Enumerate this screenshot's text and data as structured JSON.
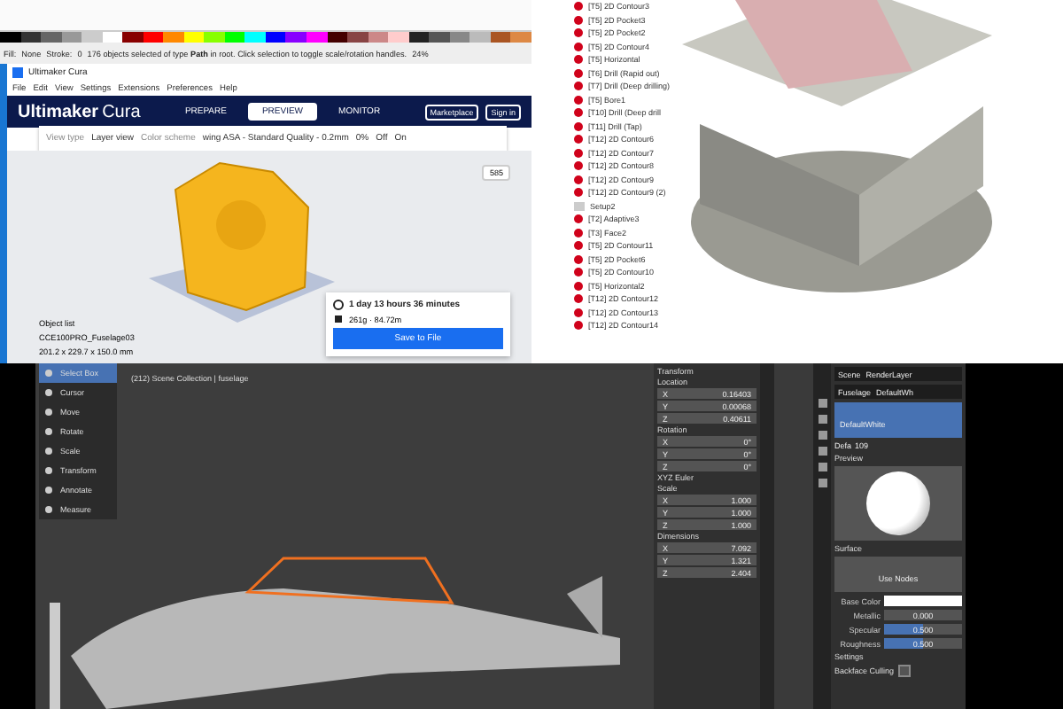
{
  "inkscape": {
    "fill_label": "Fill:",
    "fill_value": "None",
    "stroke_label": "Stroke:",
    "opacity": "0",
    "status": "176 objects selected of type **Path** in root. Click selection to toggle scale/rotation handles.",
    "zoom": "24%"
  },
  "cura": {
    "title": "Ultimaker Cura",
    "menu": [
      "File",
      "Edit",
      "View",
      "Settings",
      "Extensions",
      "Preferences",
      "Help"
    ],
    "brand": "Ultimaker",
    "product": "Cura",
    "stages": [
      {
        "label": "PREPARE",
        "selected": false
      },
      {
        "label": "PREVIEW",
        "selected": true
      },
      {
        "label": "MONITOR",
        "selected": false
      }
    ],
    "account_buttons": [
      "Marketplace",
      "Sign in"
    ],
    "view_type_label": "View type",
    "view_type": "Layer view",
    "color_scheme": "Color scheme",
    "profile": "wing ASA - Standard Quality - 0.2mm",
    "support": "0%",
    "adhesion": "Off",
    "infill": "On",
    "layer": "585",
    "object_list": "Object list",
    "file_name": "CCE100PRO_Fuselage03",
    "dimensions": "201.2 x 229.7 x 150.0 mm",
    "print_time": "1 day 13 hours 36 minutes",
    "material": "261g · 84.72m",
    "save_button": "Save to File"
  },
  "cam_tree": [
    {
      "kind": "op",
      "label": "[T5] 2D Contour3"
    },
    {
      "kind": "op",
      "label": "[T5] 2D Pocket3"
    },
    {
      "kind": "op",
      "label": "[T5] 2D Pocket2"
    },
    {
      "kind": "op",
      "label": "[T5] 2D Contour4"
    },
    {
      "kind": "op",
      "label": "[T5] Horizontal"
    },
    {
      "kind": "op",
      "label": "[T6] Drill (Rapid out)"
    },
    {
      "kind": "op",
      "label": "[T7] Drill (Deep drilling)"
    },
    {
      "kind": "op",
      "label": "[T5] Bore1"
    },
    {
      "kind": "op",
      "label": "[T10] Drill (Deep drill"
    },
    {
      "kind": "op",
      "label": "[T11] Drill (Tap)"
    },
    {
      "kind": "op",
      "label": "[T12] 2D Contour6"
    },
    {
      "kind": "op",
      "label": "[T12] 2D Contour7"
    },
    {
      "kind": "op",
      "label": "[T12] 2D Contour8"
    },
    {
      "kind": "op",
      "label": "[T12] 2D Contour9"
    },
    {
      "kind": "op",
      "label": "[T12] 2D Contour9 (2)"
    },
    {
      "kind": "setup",
      "label": "Setup2"
    },
    {
      "kind": "op",
      "label": "[T2] Adaptive3"
    },
    {
      "kind": "op",
      "label": "[T3] Face2"
    },
    {
      "kind": "op",
      "label": "[T5] 2D Contour11"
    },
    {
      "kind": "op",
      "label": "[T5] 2D Pocket6"
    },
    {
      "kind": "op",
      "label": "[T5] 2D Contour10"
    },
    {
      "kind": "op",
      "label": "[T5] Horizontal2"
    },
    {
      "kind": "op",
      "label": "[T12] 2D Contour12"
    },
    {
      "kind": "op",
      "label": "[T12] 2D Contour13"
    },
    {
      "kind": "op",
      "label": "[T12] 2D Contour14"
    }
  ],
  "blender": {
    "viewport_info": "(212) Scene Collection | fuselage",
    "tools": [
      {
        "label": "Select Box",
        "selected": true
      },
      {
        "label": "Cursor",
        "selected": false
      },
      {
        "label": "Move",
        "selected": false
      },
      {
        "label": "Rotate",
        "selected": false
      },
      {
        "label": "Scale",
        "selected": false
      },
      {
        "label": "Transform",
        "selected": false
      },
      {
        "label": "Annotate",
        "selected": false
      },
      {
        "label": "Measure",
        "selected": false
      }
    ],
    "scene": "Scene",
    "render_layer": "RenderLayer",
    "transform": {
      "title": "Transform",
      "groups": [
        {
          "title": "Location",
          "fields": [
            {
              "axis": "X",
              "value": "0.16403"
            },
            {
              "axis": "Y",
              "value": "0.00068"
            },
            {
              "axis": "Z",
              "value": "0.40611"
            }
          ]
        },
        {
          "title": "Rotation",
          "fields": [
            {
              "axis": "X",
              "value": "0°"
            },
            {
              "axis": "Y",
              "value": "0°"
            },
            {
              "axis": "Z",
              "value": "0°"
            }
          ],
          "mode": "XYZ Euler"
        },
        {
          "title": "Scale",
          "fields": [
            {
              "axis": "X",
              "value": "1.000"
            },
            {
              "axis": "Y",
              "value": "1.000"
            },
            {
              "axis": "Z",
              "value": "1.000"
            }
          ]
        },
        {
          "title": "Dimensions",
          "fields": [
            {
              "axis": "X",
              "value": "7.092"
            },
            {
              "axis": "Y",
              "value": "1.321"
            },
            {
              "axis": "Z",
              "value": "2.404"
            }
          ]
        }
      ]
    },
    "material": {
      "object": "Fuselage",
      "slot": "DefaultWhite",
      "header_material": "DefaultWh",
      "datablock": "Defa",
      "users": "109",
      "preview": "Preview",
      "surface": "Surface",
      "use_nodes": "Use Nodes",
      "base_color_label": "Base Color",
      "sliders": [
        {
          "kind": "number",
          "label": "Metallic",
          "value": "0.000"
        },
        {
          "kind": "slider",
          "label": "Specular",
          "value": "0.500",
          "level": 0.5
        },
        {
          "kind": "slider",
          "label": "Roughness",
          "value": "0.500",
          "level": 0.5
        }
      ],
      "settings": "Settings",
      "backface": "Backface Culling",
      "backface_checked": false
    }
  }
}
